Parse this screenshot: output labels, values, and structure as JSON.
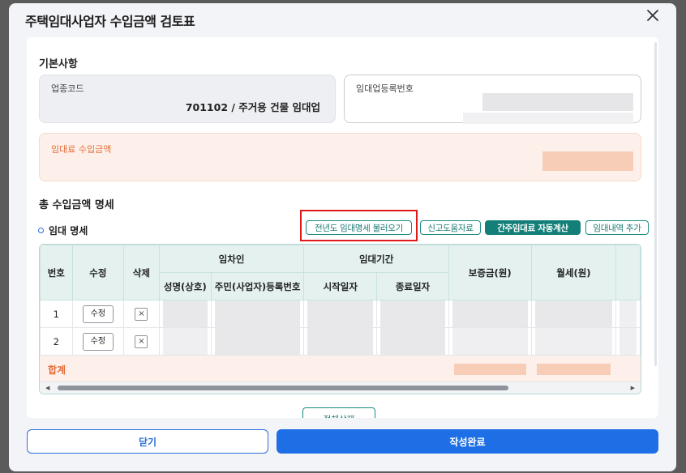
{
  "modal": {
    "title": "주택임대사업자 수입금액 검토표"
  },
  "basic_info": {
    "section_title": "기본사항",
    "industry_code_label": "업종코드",
    "industry_code_value": "701102 / 주거용 건물 임대업",
    "registration_number_label": "임대업등록번호",
    "rental_income_label": "임대료 수입금액"
  },
  "rental_details": {
    "section_title": "총 수입금액 명세",
    "sub_title": "임대 명세",
    "buttons": {
      "load_prev_year": "전년도 임대명세 불러오기",
      "report_help": "신고도움자료",
      "auto_calc": "간주임대료 자동계산",
      "add_row": "임대내역 추가"
    },
    "columns": {
      "no": "번호",
      "edit": "수정",
      "delete": "삭제",
      "tenant_group": "임차인",
      "tenant_name": "성명(상호)",
      "tenant_id": "주민(사업자)등록번호",
      "period_group": "임대기간",
      "start_date": "시작일자",
      "end_date": "종료일자",
      "deposit": "보증금(원)",
      "monthly_rent": "월세(원)"
    },
    "rows": [
      {
        "no": "1",
        "edit_label": "수정",
        "delete_label": "×"
      },
      {
        "no": "2",
        "edit_label": "수정",
        "delete_label": "×"
      }
    ],
    "total_label": "합계",
    "partial_button": "전체삭제"
  },
  "footer": {
    "close_label": "닫기",
    "complete_label": "작성완료"
  },
  "colors": {
    "primary_blue": "#1e6fe6",
    "teal": "#137f78",
    "orange_text": "#e46d3a",
    "highlight_red": "#e01818"
  }
}
